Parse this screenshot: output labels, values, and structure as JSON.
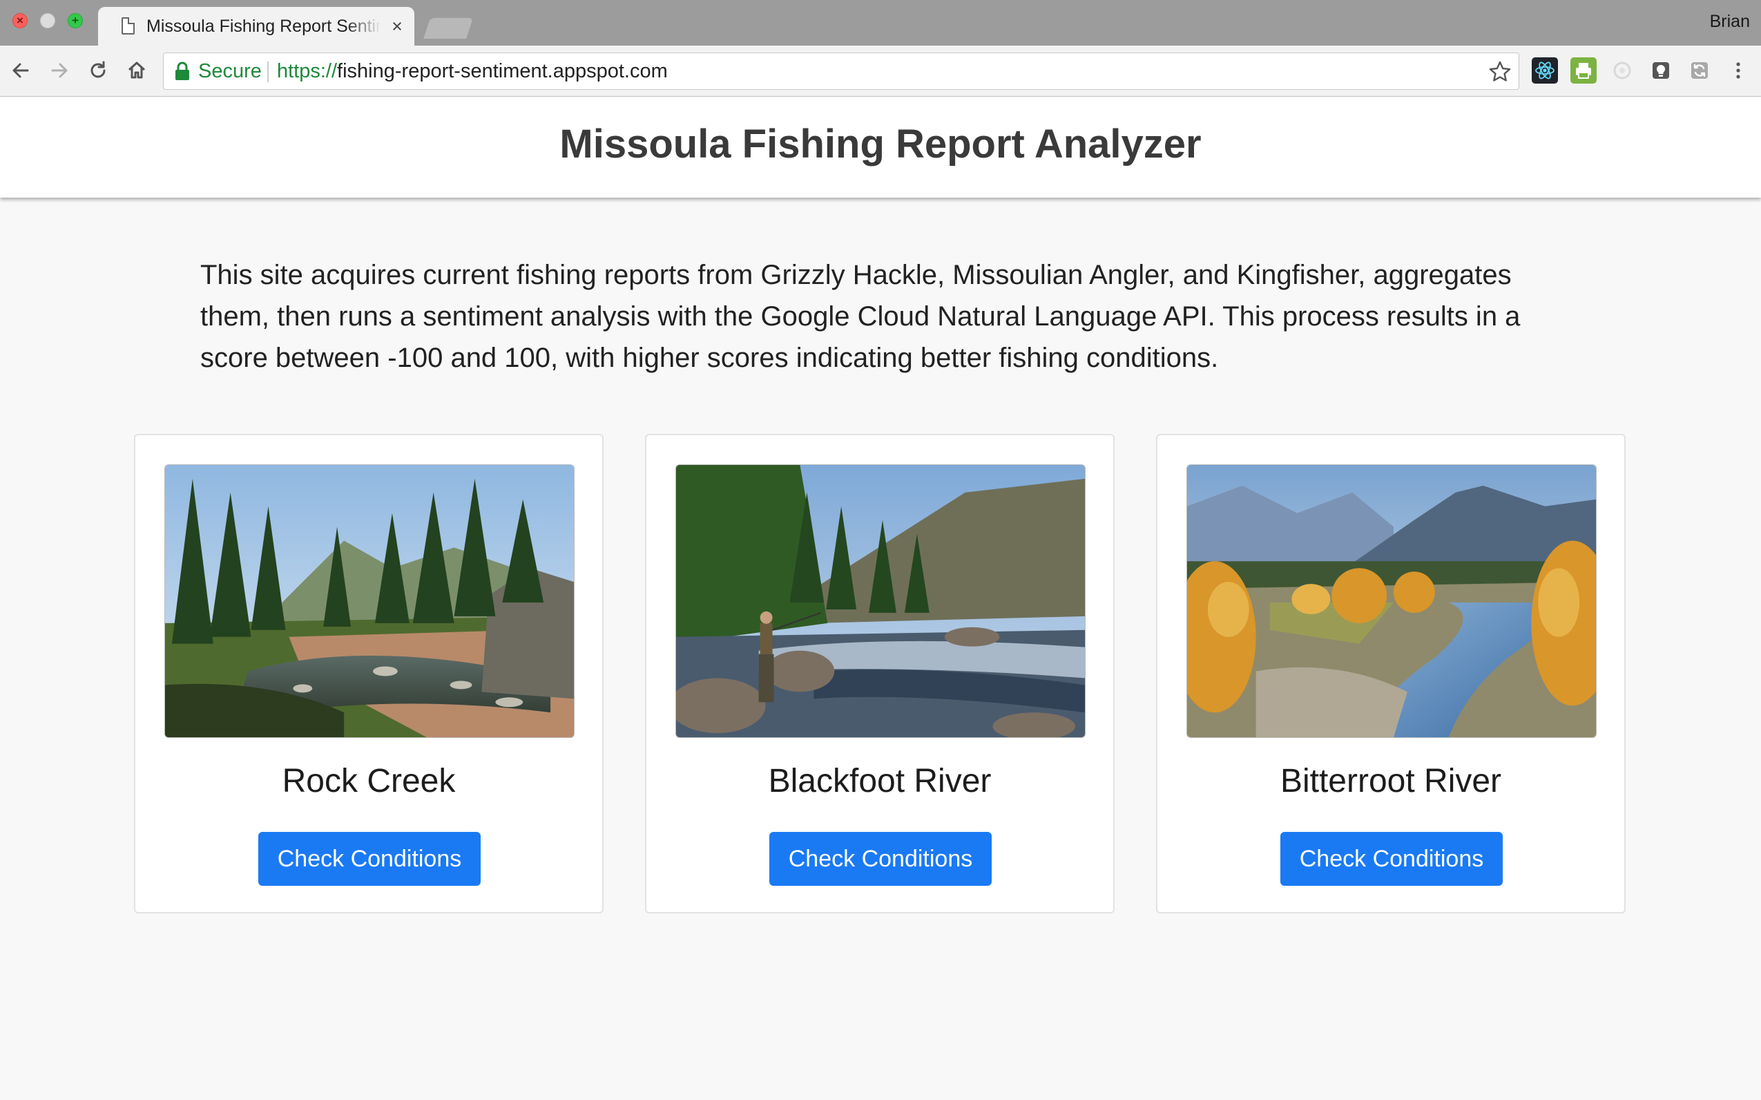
{
  "browser": {
    "tab_title": "Missoula Fishing Report Sentiment",
    "tab_close": "×",
    "profile_name": "Brian",
    "security_label": "Secure",
    "url_scheme": "https://",
    "url_rest": "fishing-report-sentiment.appspot.com",
    "nav_icons": [
      "back-arrow-icon",
      "forward-arrow-icon",
      "reload-icon",
      "home-icon"
    ],
    "extension_icons": [
      "react-devtools-icon",
      "print-icon",
      "extension-disabled-icon",
      "lightbulb-icon",
      "sync-icon",
      "menu-dots-icon"
    ]
  },
  "page": {
    "title": "Missoula Fishing Report Analyzer",
    "intro": "This site acquires current fishing reports from Grizzly Hackle, Missoulian Angler, and Kingfisher, aggregates them, then runs a sentiment analysis with the Google Cloud Natural Language API. This process results in a score between -100 and 100, with higher scores indicating better fishing conditions."
  },
  "cards": [
    {
      "name": "Rock Creek",
      "button_label": "Check Conditions",
      "image": "rock-creek-photo"
    },
    {
      "name": "Blackfoot River",
      "button_label": "Check Conditions",
      "image": "blackfoot-river-photo"
    },
    {
      "name": "Bitterroot River",
      "button_label": "Check Conditions",
      "image": "bitterroot-river-photo"
    }
  ],
  "colors": {
    "primary_button": "#1a7af4",
    "secure_green": "#1e8a3a",
    "page_background": "#f8f8f8"
  }
}
